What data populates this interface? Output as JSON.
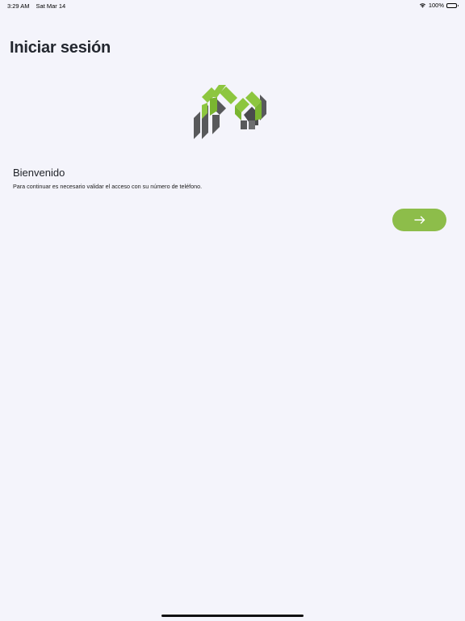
{
  "status_bar": {
    "time": "3:29 AM",
    "date": "Sat Mar 14",
    "battery": "100%",
    "icons": [
      "wifi-icon",
      "battery-icon"
    ]
  },
  "header": {
    "title": "Iniciar sesión"
  },
  "logo": {
    "icon": "logo",
    "colors": {
      "green": "#8dc63f",
      "dark_gray": "#58595b"
    }
  },
  "welcome": {
    "heading": "Bienvenido",
    "text": "Para continuar es necesario validar el acceso con su número de teléfono."
  },
  "continue_button": {
    "icon": "arrow-right-icon",
    "color": "#8dbd4a"
  }
}
